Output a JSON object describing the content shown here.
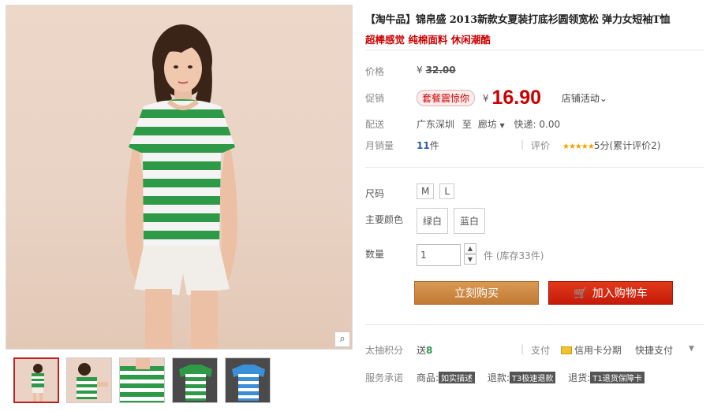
{
  "product": {
    "title": "【淘牛品】锦帛盛 2013新款女夏装打底衫圆领宽松 弹力女短袖T恤",
    "subtitle": "超棒感觉 纯棉面料 休闲潮酷"
  },
  "price": {
    "label": "价格",
    "currency": "¥",
    "original": "32.00"
  },
  "promo": {
    "label": "促销",
    "tag": "套餐震惊你",
    "currency": "¥",
    "price": "16.90",
    "shop_activity": "店铺活动"
  },
  "shipping": {
    "label": "配送",
    "from": "广东深圳",
    "to_word": "至",
    "to_city": "廊坊",
    "express": "快递: 0.00"
  },
  "sales": {
    "label": "月销量",
    "count": "11",
    "unit": "件",
    "rating_label": "评价",
    "stars": "★★★★★",
    "rating_text": "5分(累计评价2)"
  },
  "size": {
    "label": "尺码",
    "options": [
      "M",
      "L"
    ]
  },
  "color": {
    "label": "主要颜色",
    "options": [
      "绿白",
      "蓝白"
    ]
  },
  "quantity": {
    "label": "数量",
    "value": "1",
    "unit": "件",
    "stock": "(库存33件)"
  },
  "actions": {
    "buy_now": "立刻购买",
    "add_to_cart": "加入购物车"
  },
  "points": {
    "label": "太抽积分",
    "value_prefix": "送",
    "value": "8",
    "pay_label": "支付",
    "credit": "信用卡分期",
    "quick_pay": "快捷支付"
  },
  "service": {
    "label": "服务承诺",
    "goods_prefix": "商品:",
    "goods_badge": "如实描述",
    "refund_prefix": "退款:",
    "refund_badge": "T3极速退款",
    "return_prefix": "退货:",
    "return_badge": "T1退货保障卡"
  },
  "colors": {
    "accent_red": "#cc0000",
    "buy_orange": "#c27a33",
    "cart_red": "#c51a08",
    "stripe_green": "#2e9a48",
    "stripe_blue": "#3b8fd6"
  }
}
